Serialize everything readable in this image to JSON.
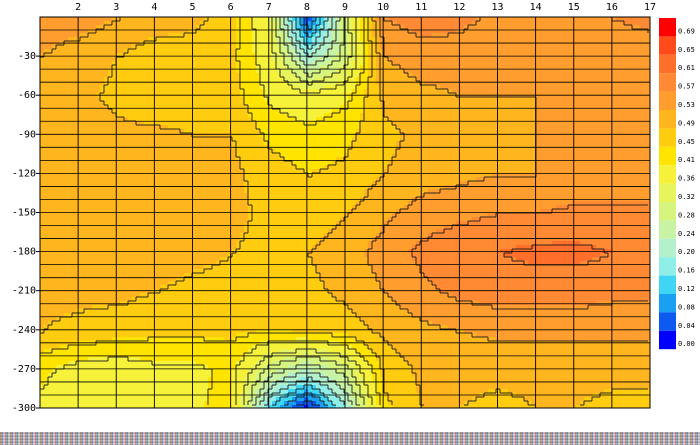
{
  "chart_data": {
    "type": "heatmap",
    "title": "",
    "xlabel": "",
    "ylabel": "",
    "x_ticks": [
      2,
      3,
      4,
      5,
      6,
      7,
      8,
      9,
      10,
      11,
      12,
      13,
      14,
      15,
      16,
      17
    ],
    "y_ticks": [
      -30,
      -60,
      -90,
      -120,
      -150,
      -180,
      -210,
      -240,
      -270,
      -300
    ],
    "xlim": [
      1,
      17
    ],
    "ylim": [
      -300,
      0
    ],
    "colorbar": {
      "levels": [
        "0.69",
        "0.65",
        "0.61",
        "0.57",
        "0.53",
        "0.49",
        "0.45",
        "0.41",
        "0.36",
        "0.32",
        "0.28",
        "0.24",
        "0.20",
        "0.16",
        "0.12",
        "0.08",
        "0.04",
        "0.00"
      ],
      "colors": [
        "#ff0000",
        "#ff4a1a",
        "#ff6e2a",
        "#ff8a33",
        "#ff9e2e",
        "#ffb51e",
        "#ffcc10",
        "#ffe400",
        "#f6f23a",
        "#e7f45c",
        "#d6f57e",
        "#c9f3a4",
        "#b3f0cc",
        "#8feee8",
        "#3fd6f6",
        "#1aa0f2",
        "#0c5af0",
        "#0000ff"
      ]
    },
    "field": {
      "x": [
        1,
        2,
        3,
        4,
        5,
        6,
        7,
        8,
        9,
        10,
        11,
        12,
        13,
        14,
        15,
        16,
        17
      ],
      "y": [
        0,
        -30,
        -60,
        -90,
        -120,
        -150,
        -180,
        -210,
        -240,
        -270,
        -300
      ],
      "z": [
        [
          0.55,
          0.55,
          0.53,
          0.52,
          0.5,
          0.47,
          0.36,
          0.04,
          0.3,
          0.57,
          0.59,
          0.58,
          0.56,
          0.55,
          0.56,
          0.57,
          0.58
        ],
        [
          0.53,
          0.51,
          0.49,
          0.46,
          0.47,
          0.46,
          0.38,
          0.2,
          0.3,
          0.53,
          0.55,
          0.55,
          0.54,
          0.54,
          0.55,
          0.55,
          0.55
        ],
        [
          0.52,
          0.5,
          0.48,
          0.46,
          0.47,
          0.47,
          0.4,
          0.38,
          0.4,
          0.5,
          0.52,
          0.53,
          0.53,
          0.53,
          0.54,
          0.54,
          0.54
        ],
        [
          0.52,
          0.51,
          0.5,
          0.5,
          0.49,
          0.49,
          0.44,
          0.42,
          0.44,
          0.48,
          0.5,
          0.51,
          0.52,
          0.53,
          0.53,
          0.53,
          0.53
        ],
        [
          0.52,
          0.52,
          0.51,
          0.51,
          0.5,
          0.5,
          0.47,
          0.45,
          0.46,
          0.49,
          0.51,
          0.52,
          0.53,
          0.53,
          0.54,
          0.54,
          0.54
        ],
        [
          0.52,
          0.53,
          0.52,
          0.52,
          0.51,
          0.5,
          0.48,
          0.47,
          0.49,
          0.52,
          0.55,
          0.56,
          0.57,
          0.57,
          0.58,
          0.58,
          0.58
        ],
        [
          0.52,
          0.52,
          0.51,
          0.51,
          0.5,
          0.49,
          0.48,
          0.49,
          0.51,
          0.55,
          0.58,
          0.6,
          0.61,
          0.62,
          0.62,
          0.61,
          0.6
        ],
        [
          0.5,
          0.5,
          0.5,
          0.49,
          0.48,
          0.48,
          0.48,
          0.48,
          0.5,
          0.53,
          0.56,
          0.58,
          0.59,
          0.59,
          0.59,
          0.58,
          0.58
        ],
        [
          0.49,
          0.48,
          0.47,
          0.46,
          0.46,
          0.46,
          0.45,
          0.46,
          0.47,
          0.5,
          0.52,
          0.53,
          0.54,
          0.54,
          0.54,
          0.54,
          0.54
        ],
        [
          0.42,
          0.39,
          0.38,
          0.4,
          0.4,
          0.42,
          0.3,
          0.24,
          0.3,
          0.46,
          0.5,
          0.5,
          0.5,
          0.5,
          0.5,
          0.5,
          0.5
        ],
        [
          0.4,
          0.38,
          0.38,
          0.4,
          0.4,
          0.43,
          0.15,
          0.02,
          0.2,
          0.44,
          0.49,
          0.49,
          0.48,
          0.49,
          0.49,
          0.48,
          0.48
        ]
      ]
    },
    "grid": true,
    "colorbar_placement": "right"
  }
}
